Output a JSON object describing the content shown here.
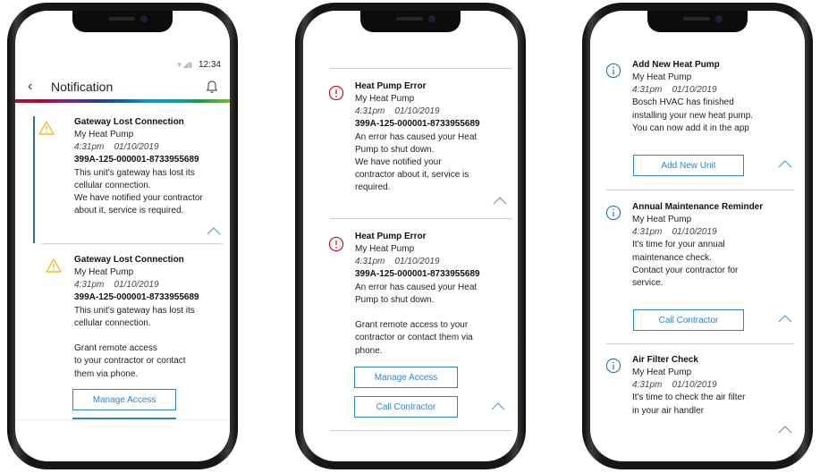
{
  "statusbar": {
    "time": "12:34",
    "icons": "▼◢▮"
  },
  "header": {
    "back": "‹",
    "title": "Notification"
  },
  "phone1": {
    "card1": {
      "title": "Gateway Lost Connection",
      "device": "My Heat Pump",
      "time": "4:31pm",
      "date": "01/10/2019",
      "code": "399A-125-000001-8733955689",
      "lines": [
        "This unit's gateway has lost its",
        "cellular connection.",
        "We have notified your contractor",
        "about it, service is required."
      ]
    },
    "card2": {
      "title": "Gateway Lost Connection",
      "device": "My Heat Pump",
      "time": "4:31pm",
      "date": "01/10/2019",
      "code": "399A-125-000001-8733955689",
      "lines": [
        "This unit's gateway has lost its",
        "cellular connection.",
        "",
        "Grant remote access",
        "to your contractor or contact",
        "them via phone."
      ],
      "button": "Manage Access"
    }
  },
  "phone2": {
    "card1": {
      "title": "Heat Pump Error",
      "device": "My Heat Pump",
      "time": "4:31pm",
      "date": "01/10/2019",
      "code": "399A-125-000001-8733955689",
      "lines": [
        "An error has caused your Heat",
        "Pump to shut down.",
        "We have notified your",
        "contractor about it, service is",
        "required."
      ]
    },
    "card2": {
      "title": "Heat Pump Error",
      "device": "My Heat Pump",
      "time": "4:31pm",
      "date": "01/10/2019",
      "code": "399A-125-000001-8733955689",
      "lines": [
        "An error has caused your Heat",
        "Pump to shut down.",
        "",
        "Grant remote access to your",
        "contractor or contact them via",
        "phone."
      ],
      "button1": "Manage Access",
      "button2": "Call Contractor"
    }
  },
  "phone3": {
    "card1": {
      "title": "Add New Heat Pump",
      "device": "My Heat Pump",
      "time": "4:31pm",
      "date": "01/10/2019",
      "lines": [
        "Bosch HVAC has finished",
        "installing your new heat pump.",
        "You can now add it in the app"
      ],
      "button": "Add New Unit"
    },
    "card2": {
      "title": "Annual Maintenance Reminder",
      "device": "My Heat Pump",
      "time": "4:31pm",
      "date": "01/10/2019",
      "lines": [
        "It's time for your annual",
        "maintenance check.",
        "Contact your contractor for",
        "service."
      ],
      "button": "Call Contractor"
    },
    "card3": {
      "title": "Air Filter Check",
      "device": "My Heat Pump",
      "time": "4:31pm",
      "date": "01/10/2019",
      "lines": [
        "It's time to check the air filter",
        "in your air handler"
      ]
    }
  },
  "colors": {
    "accent": "#2f83c9",
    "warning": "#f2b200",
    "error": "#d0021b",
    "info": "#2f6fb0"
  }
}
